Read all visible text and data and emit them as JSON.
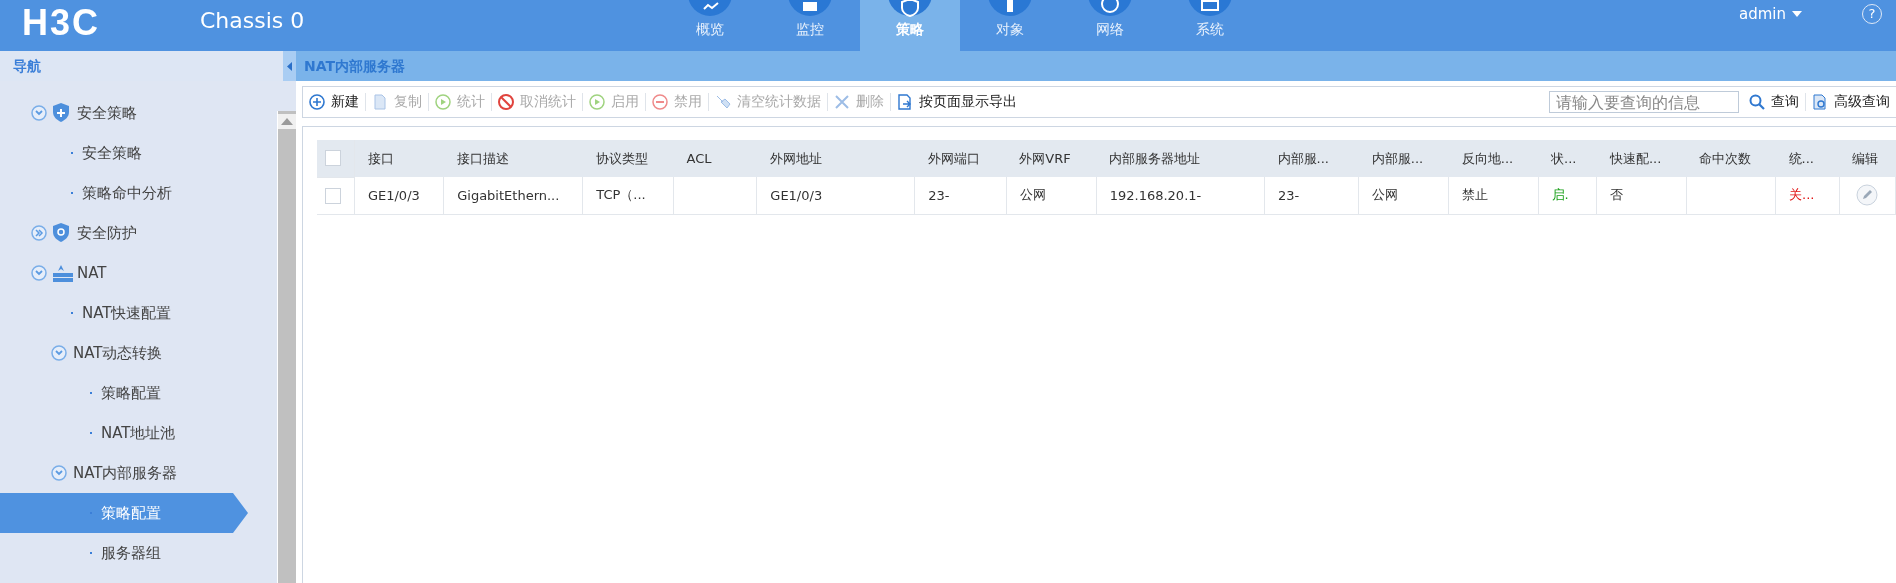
{
  "header": {
    "logo": "H3C",
    "device": "Chassis 0",
    "user": "admin",
    "help": "?"
  },
  "nav_tabs": [
    {
      "label": "概览",
      "selected": false
    },
    {
      "label": "监控",
      "selected": false
    },
    {
      "label": "策略",
      "selected": true
    },
    {
      "label": "对象",
      "selected": false
    },
    {
      "label": "网络",
      "selected": false
    },
    {
      "label": "系统",
      "selected": false
    }
  ],
  "sidebar": {
    "title": "导航",
    "items": [
      {
        "label": "安全策略",
        "expanded": true,
        "children": [
          {
            "label": "安全策略",
            "selected": false
          },
          {
            "label": "策略命中分析",
            "selected": false
          }
        ]
      },
      {
        "label": "安全防护",
        "expanded": false
      },
      {
        "label": "NAT",
        "expanded": true,
        "children": [
          {
            "label": "NAT快速配置",
            "selected": false
          },
          {
            "label": "NAT动态转换",
            "expanded": true,
            "children": [
              {
                "label": "策略配置",
                "selected": false
              },
              {
                "label": "NAT地址池",
                "selected": false
              }
            ]
          },
          {
            "label": "NAT内部服务器",
            "expanded": true,
            "children": [
              {
                "label": "策略配置",
                "selected": true
              },
              {
                "label": "服务器组",
                "selected": false
              }
            ]
          }
        ]
      }
    ]
  },
  "page": {
    "title": "NAT内部服务器"
  },
  "toolbar": [
    {
      "label": "新建",
      "disabled": false
    },
    {
      "label": "复制",
      "disabled": true
    },
    {
      "label": "统计",
      "disabled": true
    },
    {
      "label": "取消统计",
      "disabled": true
    },
    {
      "label": "启用",
      "disabled": true
    },
    {
      "label": "禁用",
      "disabled": true
    },
    {
      "label": "清空统计数据",
      "disabled": true
    },
    {
      "label": "删除",
      "disabled": true
    },
    {
      "label": "按页面显示导出",
      "disabled": false
    }
  ],
  "search": {
    "placeholder": "请输入要查询的信息",
    "button": "查询",
    "advanced": "高级查询"
  },
  "table": {
    "columns": [
      "接口",
      "接口描述",
      "协议类型",
      "ACL",
      "外网地址",
      "外网端口",
      "外网VRF",
      "内部服务器地址",
      "内部服...",
      "内部服...",
      "反向地...",
      "状...",
      "快速配...",
      "命中次数",
      "统...",
      "编辑"
    ],
    "all_checked": false,
    "rows": [
      {
        "checked": false,
        "cells": [
          {
            "kind": "text",
            "text": "GE1/0/3"
          },
          {
            "kind": "text",
            "text": "GigabitEthern..."
          },
          {
            "kind": "text",
            "text": "TCP（..."
          },
          {
            "kind": "empty"
          },
          {
            "kind": "text",
            "text": "GE1/0/3"
          },
          {
            "kind": "text",
            "text": "23-"
          },
          {
            "kind": "text",
            "text": "公网"
          },
          {
            "kind": "text",
            "text": "192.168.20.1-"
          },
          {
            "kind": "text",
            "text": "23-"
          },
          {
            "kind": "text",
            "text": "公网"
          },
          {
            "kind": "text",
            "text": "禁止"
          },
          {
            "kind": "status",
            "text": "启.",
            "on": true
          },
          {
            "kind": "text",
            "text": "否"
          },
          {
            "kind": "empty"
          },
          {
            "kind": "status",
            "text": "关...",
            "on": false
          },
          {
            "kind": "edit"
          }
        ]
      }
    ]
  }
}
